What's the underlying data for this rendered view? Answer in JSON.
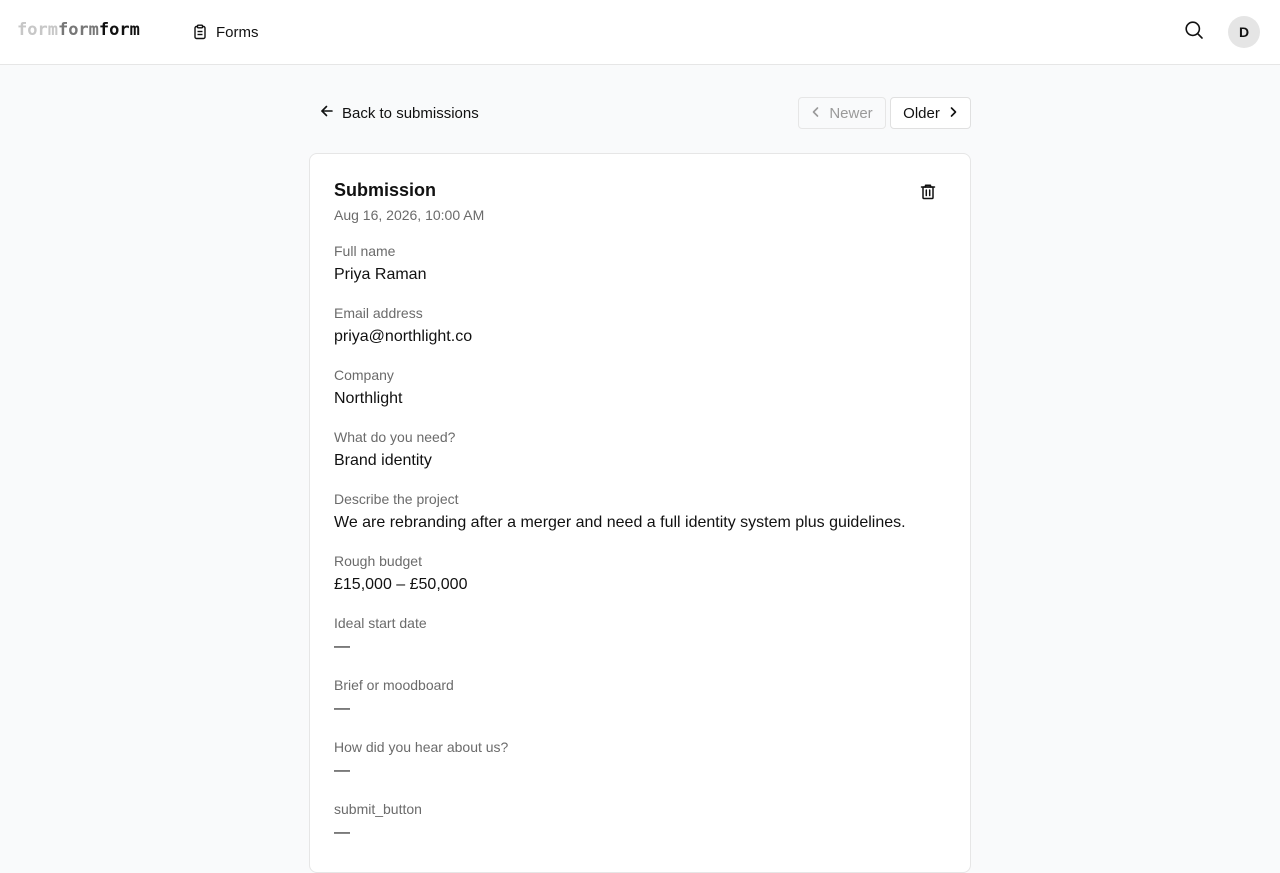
{
  "app": {
    "logo": [
      "form",
      "form",
      "form"
    ],
    "nav_forms_label": "Forms",
    "avatar_initial": "D"
  },
  "header": {
    "back_label": "Back to submissions",
    "newer_label": "Newer",
    "older_label": "Older"
  },
  "submission": {
    "title": "Submission",
    "date": "Aug 16, 2026, 10:00 AM",
    "fields": [
      {
        "label": "Full name",
        "value": "Priya Raman"
      },
      {
        "label": "Email address",
        "value": "priya@northlight.co"
      },
      {
        "label": "Company",
        "value": "Northlight"
      },
      {
        "label": "What do you need?",
        "value": "Brand identity"
      },
      {
        "label": "Describe the project",
        "value": "We are rebranding after a merger and need a full identity system plus guidelines."
      },
      {
        "label": "Rough budget",
        "value": "£15,000 – £50,000"
      },
      {
        "label": "Ideal start date",
        "value": "—"
      },
      {
        "label": "Brief or moodboard",
        "value": "—"
      },
      {
        "label": "How did you hear about us?",
        "value": "—"
      },
      {
        "label": "submit_button",
        "value": "—"
      }
    ]
  },
  "icons": {
    "forms": "clipboard-icon",
    "search": "search-icon",
    "back": "arrow-left-icon",
    "newer": "chevron-left-icon",
    "older": "chevron-right-icon",
    "delete": "trash-icon"
  }
}
